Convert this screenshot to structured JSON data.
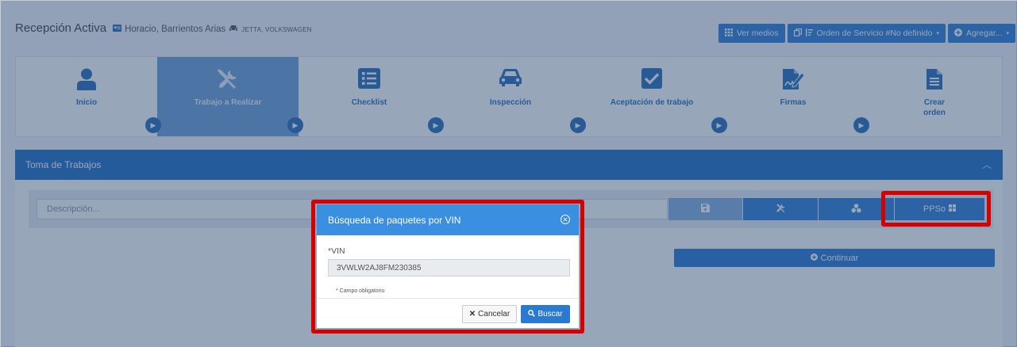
{
  "header": {
    "title": "Recepción Activa",
    "client": "Horacio, Barrientos Arias",
    "vehicle": "JETTA, VOLKSWAGEN"
  },
  "topbar": {
    "ver_medios": "Ver medios",
    "orden_servicio": "Orden de Servicio #No definido",
    "agregar": "Agregar..."
  },
  "steps": [
    {
      "label": "Inicio",
      "icon": "user-icon"
    },
    {
      "label": "Trabajo a Realizar",
      "icon": "tools-icon"
    },
    {
      "label": "Checklist",
      "icon": "list-icon"
    },
    {
      "label": "Inspección",
      "icon": "car-icon"
    },
    {
      "label": "Aceptación de trabajo",
      "icon": "check-square-icon"
    },
    {
      "label": "Firmas",
      "icon": "signature-icon"
    },
    {
      "label": "Crear orden",
      "icon": "file-icon"
    }
  ],
  "panel": {
    "title": "Toma de Trabajos"
  },
  "form": {
    "description_placeholder": "Descripción...",
    "ppso_label": "PPSo",
    "continuar_label": "Continuar"
  },
  "modal": {
    "title": "Búsqueda de paquetes por VIN",
    "vin_label": "*VIN",
    "vin_value": "3VWLW2AJ8FM230385",
    "required_note": "* Campo obligatorio",
    "cancel_label": "Cancelar",
    "search_label": "Buscar"
  },
  "colors": {
    "primary": "#2a7ad3",
    "highlight": "#d50000"
  }
}
